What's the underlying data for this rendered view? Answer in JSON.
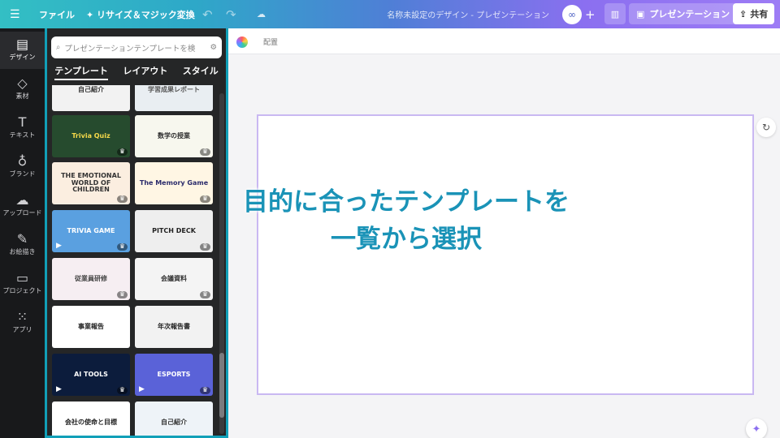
{
  "topbar": {
    "menu_icon": "menu-icon",
    "file": "ファイル",
    "resize": "✦ リサイズ＆マジック変換",
    "undo_icon": "↶",
    "redo_icon": "↷",
    "cloud_icon": "☁",
    "title": "名称未設定のデザイン - プレゼンテーション",
    "avatar": "∞",
    "plus": "+",
    "stats_icon": "▥",
    "present_icon": "▣",
    "present": "プレゼンテーション",
    "share_icon": "⇪",
    "share": "共有"
  },
  "rail": {
    "items": [
      {
        "icon": "▤",
        "label": "デザイン"
      },
      {
        "icon": "◇",
        "label": "素材"
      },
      {
        "icon": "T",
        "label": "テキスト"
      },
      {
        "icon": "♁",
        "label": "ブランド"
      },
      {
        "icon": "☁",
        "label": "アップロード"
      },
      {
        "icon": "✎",
        "label": "お絵描き"
      },
      {
        "icon": "▭",
        "label": "プロジェクト"
      },
      {
        "icon": "⁙",
        "label": "アプリ"
      }
    ]
  },
  "panel": {
    "search_placeholder": "プレゼンテーションテンプレートを検",
    "filter_icon": "⚙",
    "tabs": [
      "テンプレート",
      "レイアウト",
      "スタイル"
    ],
    "thumbs": [
      {
        "text": "自己紹介",
        "bg": "#f2f2f2",
        "fg": "#333"
      },
      {
        "text": "学習成果レポート",
        "bg": "#e9eef2",
        "fg": "#555"
      },
      {
        "text": "Trivia Quiz",
        "bg": "#264b2e",
        "fg": "#f6d94a"
      },
      {
        "text": "数学の授業",
        "bg": "#f7f7ee",
        "fg": "#2c2c2c"
      },
      {
        "text": "THE EMOTIONAL WORLD OF CHILDREN",
        "bg": "#fbeee0",
        "fg": "#333"
      },
      {
        "text": "The Memory Game",
        "bg": "#fff6e4",
        "fg": "#2b2b6b"
      },
      {
        "text": "TRIVIA GAME",
        "bg": "#5aa0e0",
        "fg": "#fff"
      },
      {
        "text": "PITCH DECK",
        "bg": "#eeeeee",
        "fg": "#222"
      },
      {
        "text": "従業員研修",
        "bg": "#f6eef2",
        "fg": "#444"
      },
      {
        "text": "会議資料",
        "bg": "#f4f4f4",
        "fg": "#333"
      },
      {
        "text": "事業報告",
        "bg": "#ffffff",
        "fg": "#222"
      },
      {
        "text": "年次報告書",
        "bg": "#f2f2f2",
        "fg": "#222"
      },
      {
        "text": "AI TOOLS",
        "bg": "#0c1c3c",
        "fg": "#fff"
      },
      {
        "text": "ESPORTS",
        "bg": "#5a62d8",
        "fg": "#fff"
      },
      {
        "text": "会社の使命と目標",
        "bg": "#ffffff",
        "fg": "#222"
      },
      {
        "text": "自己紹介",
        "bg": "#eef3f8",
        "fg": "#333"
      }
    ],
    "crown": "♛",
    "play": "▶"
  },
  "canvas": {
    "toolbar_label": "配置",
    "page_tool_icon": "↻",
    "magic_icon": "✦",
    "overlay_line1": "目的に合ったテンプレートを",
    "overlay_line2": "一覧から選択"
  }
}
